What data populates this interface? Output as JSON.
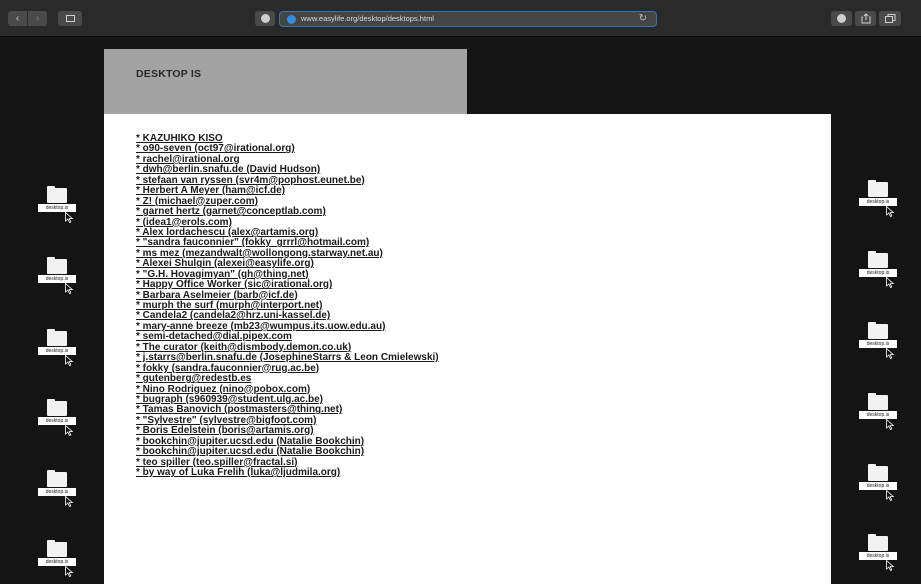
{
  "browser": {
    "url": "www.easylife.org/desktop/desktops.html",
    "nav_back": "‹",
    "nav_forward": "›",
    "reload": "↻"
  },
  "page": {
    "title": "DESKTOP IS",
    "links": [
      "* KAZUHIKO KISO",
      "* o90-seven (oct97@irational.org)",
      "* rachel@irational.org",
      "* dwh@berlin.snafu.de (David Hudson)",
      "* stefaan van ryssen (svr4m@pophost.eunet.be)",
      "* Herbert A Meyer (ham@icf.de)",
      "* Z! (michael@zuper.com)",
      "* garnet hertz (garnet@conceptlab.com)",
      "* (idea1@erols.com)",
      "* Alex lordachescu (alex@artamis.org)",
      "* \"sandra fauconnier\" (fokky_grrrl@hotmail.com)",
      "* ms mez (mezandwalt@wollongong.starway.net.au)",
      "* Alexei Shulgin (alexei@easylife.org)",
      "* \"G.H. Hovagimyan\" (gh@thing.net)",
      "* Happy Office Worker (sic@irational.org)",
      "* Barbara Aselmeier (barb@icf.de)",
      "* murph the surf (murph@interport.net)",
      "* Candela2 (candela2@hrz.uni-kassel.de)",
      "* mary-anne breeze (mb23@wumpus.its.uow.edu.au)",
      "* semi-detached@dial.pipex.com",
      "* The curator (keith@dismbody.demon.co.uk)",
      "* j.starrs@berlin.snafu.de (JosephineStarrs & Leon Cmielewski)",
      "* fokky (sandra.fauconnier@rug.ac.be)",
      "* gutenberg@redestb.es",
      "* Nino Rodriguez (nino@pobox.com)",
      "* bugraph (s960939@student.ulg.ac.be)",
      "* Tamas Banovich (postmasters@thing.net)",
      "* \"Sylvestre\" (sylvestre@bigfoot.com)",
      "* Boris Edelstein (boris@artamis.org)",
      "* bookchin@jupiter.ucsd.edu (Natalie Bookchin)",
      "* bookchin@jupiter.ucsd.edu (Natalie Bookchin)",
      "* teo spiller (teo.spiller@fractal.si)",
      "* by way of Luka Frelih (luka@ljudmila.org)"
    ]
  },
  "desktop_icon_label": "desktop.is"
}
